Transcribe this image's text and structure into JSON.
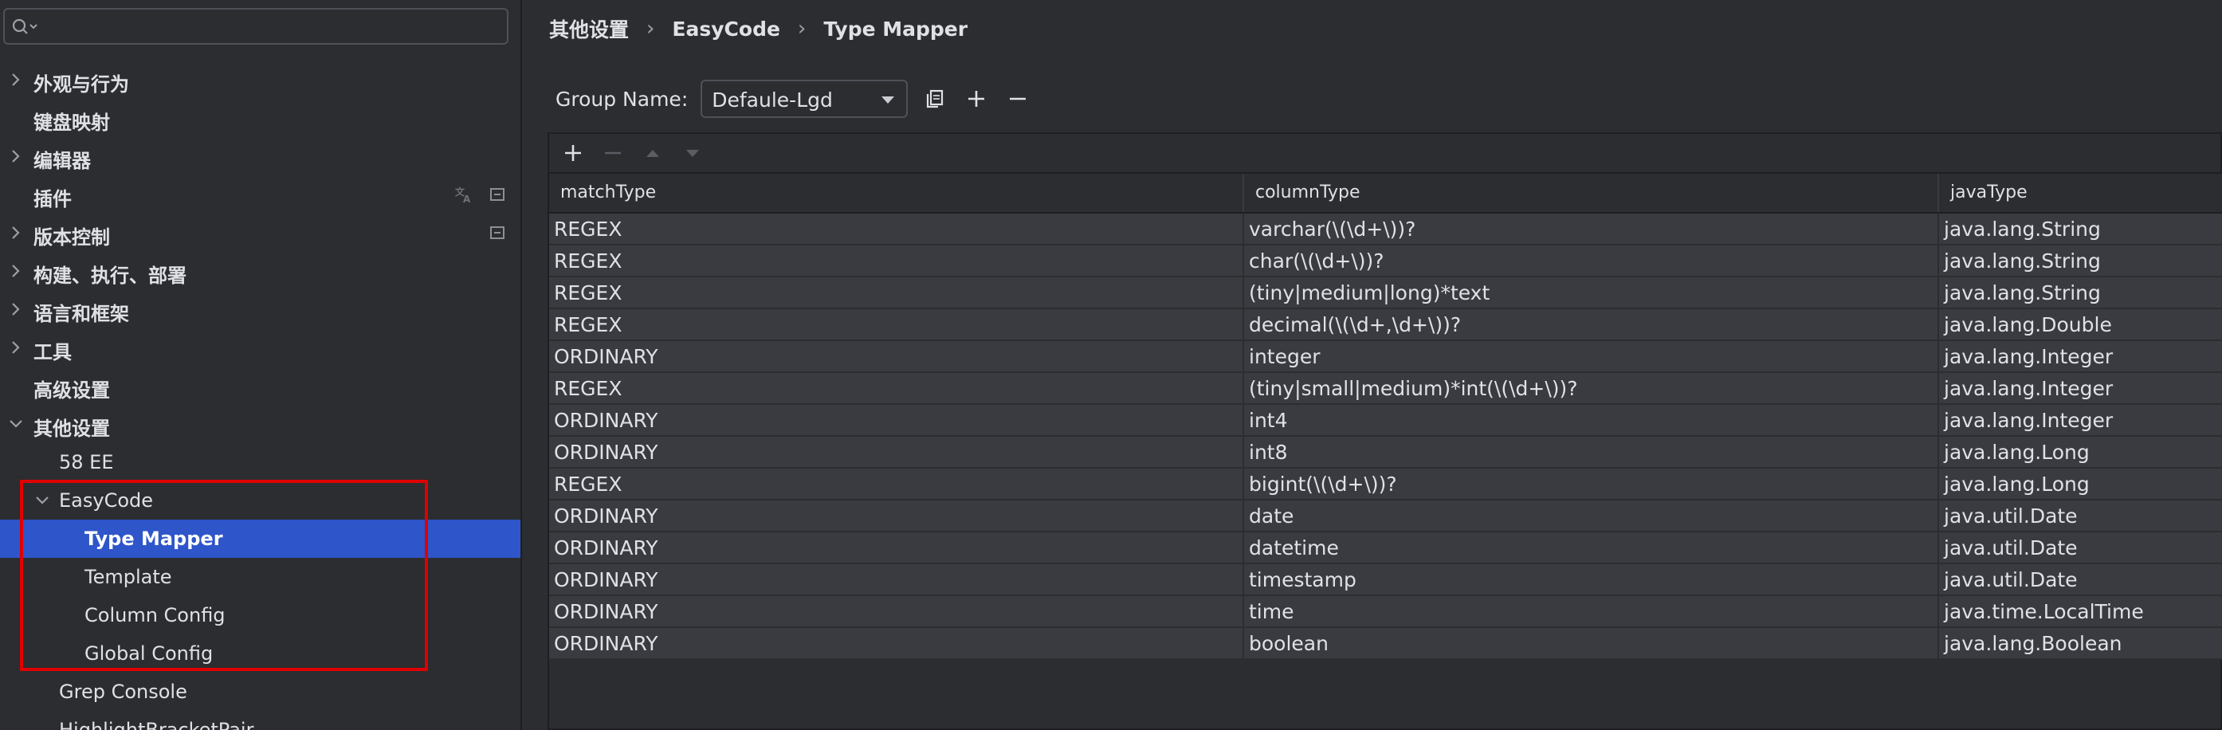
{
  "search": {
    "placeholder": ""
  },
  "sidebar": {
    "items": [
      {
        "label": "外观与行为",
        "expandable": true,
        "expanded": false
      },
      {
        "label": "键盘映射",
        "expandable": false
      },
      {
        "label": "编辑器",
        "expandable": true,
        "expanded": false
      },
      {
        "label": "插件",
        "expandable": false,
        "right_icons": [
          "translate-icon",
          "settings-scope-icon"
        ]
      },
      {
        "label": "版本控制",
        "expandable": true,
        "expanded": false,
        "right_icons": [
          "settings-scope-icon"
        ]
      },
      {
        "label": "构建、执行、部署",
        "expandable": true,
        "expanded": false
      },
      {
        "label": "语言和框架",
        "expandable": true,
        "expanded": false
      },
      {
        "label": "工具",
        "expandable": true,
        "expanded": false
      },
      {
        "label": "高级设置",
        "expandable": false
      },
      {
        "label": "其他设置",
        "expandable": true,
        "expanded": true
      },
      {
        "label": "58 EE",
        "level": 1
      },
      {
        "label": "EasyCode",
        "level": 1,
        "expandable": true,
        "expanded": true
      },
      {
        "label": "Type Mapper",
        "level": 2,
        "selected": true
      },
      {
        "label": "Template",
        "level": 2
      },
      {
        "label": "Column Config",
        "level": 2
      },
      {
        "label": "Global Config",
        "level": 2
      },
      {
        "label": "Grep Console",
        "level": 1
      },
      {
        "label": "HighlightBracketPair",
        "level": 1
      }
    ]
  },
  "breadcrumb": [
    "其他设置",
    "EasyCode",
    "Type Mapper"
  ],
  "group": {
    "label": "Group Name:",
    "selected": "Defaule-Lgd"
  },
  "table": {
    "columns": [
      "matchType",
      "columnType",
      "javaType"
    ],
    "rows": [
      [
        "REGEX",
        "varchar(\\(\\d+\\))?",
        "java.lang.String"
      ],
      [
        "REGEX",
        "char(\\(\\d+\\))?",
        "java.lang.String"
      ],
      [
        "REGEX",
        "(tiny|medium|long)*text",
        "java.lang.String"
      ],
      [
        "REGEX",
        "decimal(\\(\\d+,\\d+\\))?",
        "java.lang.Double"
      ],
      [
        "ORDINARY",
        "integer",
        "java.lang.Integer"
      ],
      [
        "REGEX",
        "(tiny|small|medium)*int(\\(\\d+\\))?",
        "java.lang.Integer"
      ],
      [
        "ORDINARY",
        "int4",
        "java.lang.Integer"
      ],
      [
        "ORDINARY",
        "int8",
        "java.lang.Long"
      ],
      [
        "REGEX",
        "bigint(\\(\\d+\\))?",
        "java.lang.Long"
      ],
      [
        "ORDINARY",
        "date",
        "java.util.Date"
      ],
      [
        "ORDINARY",
        "datetime",
        "java.util.Date"
      ],
      [
        "ORDINARY",
        "timestamp",
        "java.util.Date"
      ],
      [
        "ORDINARY",
        "time",
        "java.time.LocalTime"
      ],
      [
        "ORDINARY",
        "boolean",
        "java.lang.Boolean"
      ]
    ]
  },
  "colors": {
    "background": "#2b2d30",
    "selection": "#2e55c9",
    "row_background": "#393b40",
    "highlight_box": "#e00000"
  }
}
